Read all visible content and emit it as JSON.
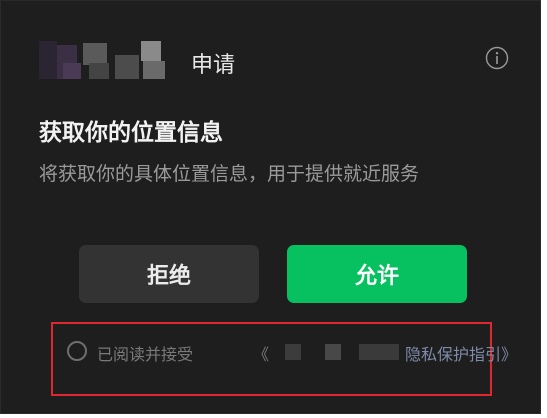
{
  "header": {
    "title": "申请",
    "logo_icon": "redacted-app-logo",
    "info_icon": "info-icon"
  },
  "request": {
    "title": "获取你的位置信息",
    "description": "将获取你的具体位置信息，用于提供就近服务"
  },
  "buttons": {
    "reject_label": "拒绝",
    "allow_label": "允许"
  },
  "agreement": {
    "checked": false,
    "prefix": "已阅读并接受",
    "policy_open": "《",
    "policy_suffix": "隐私保护指引》"
  },
  "colors": {
    "background": "#1e1e1e",
    "allow_button": "#07c160",
    "reject_button": "#333333",
    "highlight_border": "#e0262e",
    "policy_link": "#7d8aa8"
  }
}
